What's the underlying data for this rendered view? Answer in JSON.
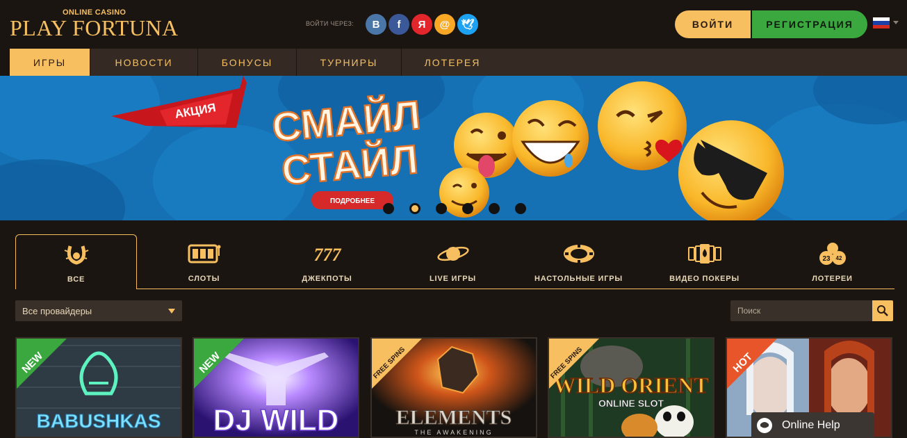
{
  "header": {
    "logo_sub": "ONLINE CASINO",
    "logo_main": "PLAY FORTUNA",
    "social_label": "ВОЙТИ ЧЕРЕЗ:",
    "social": [
      {
        "name": "vk-icon",
        "glyph": "В",
        "color": "#4a76a8"
      },
      {
        "name": "facebook-icon",
        "glyph": "f",
        "color": "#3b5998"
      },
      {
        "name": "yandex-icon",
        "glyph": "Я",
        "color": "#e3262b"
      },
      {
        "name": "mail-icon",
        "glyph": "@",
        "color": "#f9a825"
      },
      {
        "name": "twitter-icon",
        "glyph": "🕊",
        "color": "#1da1f2"
      }
    ],
    "login": "ВОЙТИ",
    "register": "РЕГИСТРАЦИЯ",
    "language": "ru"
  },
  "nav": {
    "items": [
      {
        "label": "ИГРЫ",
        "active": true
      },
      {
        "label": "НОВОСТИ",
        "active": false
      },
      {
        "label": "БОНУСЫ",
        "active": false
      },
      {
        "label": "ТУРНИРЫ",
        "active": false
      },
      {
        "label": "ЛОТЕРЕЯ",
        "active": false
      }
    ]
  },
  "banner": {
    "ribbon": "АКЦИЯ",
    "title_line1": "СМАЙЛ",
    "title_line2": "СТАЙЛ",
    "button": "ПОДРОБНЕЕ",
    "slide_count": 6,
    "active_slide": 2
  },
  "categories": [
    {
      "label": "ВСЕ",
      "icon": "horseshoe-icon",
      "active": true
    },
    {
      "label": "СЛОТЫ",
      "icon": "slot-machine-icon",
      "active": false
    },
    {
      "label": "ДЖЕКПОТЫ",
      "icon": "sevens-icon",
      "active": false
    },
    {
      "label": "LIVE ИГРЫ",
      "icon": "planet-icon",
      "active": false
    },
    {
      "label": "НАСТОЛЬНЫЕ ИГРЫ",
      "icon": "chip-icon",
      "active": false
    },
    {
      "label": "ВИДЕО ПОКЕРЫ",
      "icon": "cards-icon",
      "active": false
    },
    {
      "label": "ЛОТЕРЕИ",
      "icon": "lottery-balls-icon",
      "active": false
    }
  ],
  "lottery_icon_numbers": [
    "23",
    "42"
  ],
  "filters": {
    "provider": "Все провайдеры",
    "search_placeholder": "Поиск"
  },
  "games": [
    {
      "title": "BABUSHKAS",
      "badge": "NEW",
      "badge_color": "#3aa83f"
    },
    {
      "title": "DJ WILD",
      "badge": "NEW",
      "badge_color": "#3aa83f"
    },
    {
      "title": "ELEMENTS",
      "subtitle": "THE AWAKENING",
      "badge": "FREE SPINS",
      "badge_color": "#f7bf60"
    },
    {
      "title": "WILD ORIENT",
      "subtitle": "ONLINE SLOT",
      "badge": "FREE SPINS",
      "badge_color": "#f7bf60"
    },
    {
      "title": "",
      "badge": "HOT",
      "badge_color": "#e8552a"
    }
  ],
  "help": {
    "label": "Online Help"
  },
  "colors": {
    "accent": "#f7bf60",
    "green": "#3aa83f",
    "bg": "#1b1512"
  }
}
